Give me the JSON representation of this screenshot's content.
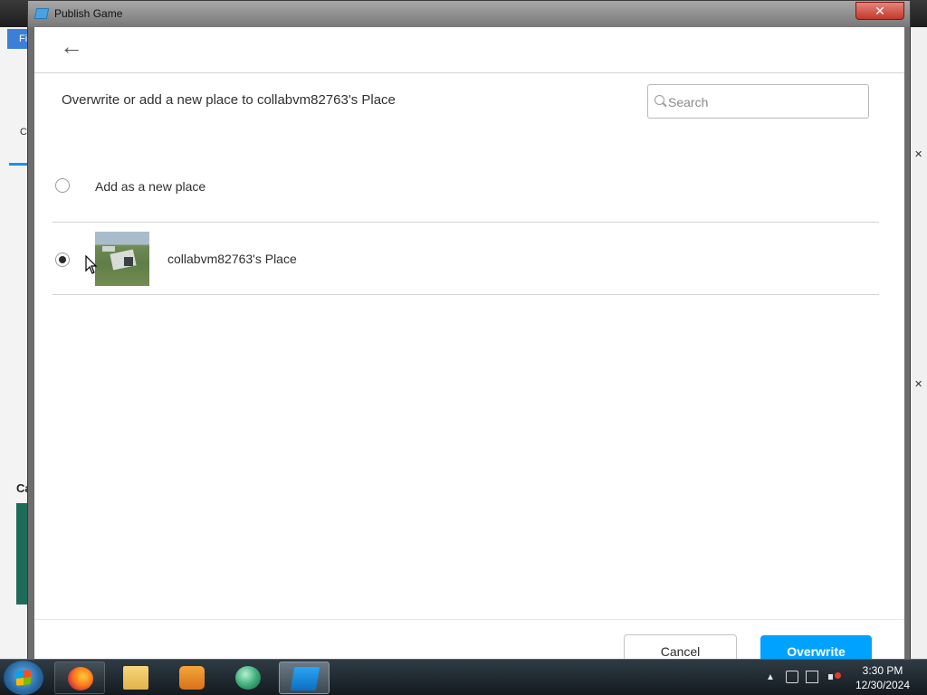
{
  "window": {
    "title": "Publish Game",
    "close_glyph": "✕"
  },
  "background_app": {
    "left_tab_label": "Fi",
    "left_c_label": "C",
    "left_ca_label": "Ca",
    "right_close_glyphs": [
      "✕",
      "✕"
    ]
  },
  "dialog": {
    "back_glyph": "←",
    "heading": "Overwrite or add a new place to collabvm82763's Place",
    "search": {
      "placeholder": "Search",
      "value": ""
    },
    "options": [
      {
        "label": "Add as a new place",
        "selected": false
      },
      {
        "label": "collabvm82763's Place",
        "selected": true,
        "thumbnail": "place-thumbnail"
      }
    ],
    "cancel_label": "Cancel",
    "overwrite_label": "Overwrite"
  },
  "taskbar": {
    "items": [
      {
        "name": "firefox",
        "icon": "firefox-icon"
      },
      {
        "name": "explorer",
        "icon": "folder-icon"
      },
      {
        "name": "media-player",
        "icon": "media-player-icon"
      },
      {
        "name": "globe",
        "icon": "globe-icon"
      },
      {
        "name": "roblox-studio",
        "icon": "roblox-studio-icon",
        "active": true
      }
    ],
    "tray_arrow": "▲",
    "clock_time": "3:30 PM",
    "clock_date": "12/30/2024"
  },
  "colors": {
    "primary_button": "#00a2ff",
    "dialog_background": "#ffffff",
    "text": "#303030"
  }
}
